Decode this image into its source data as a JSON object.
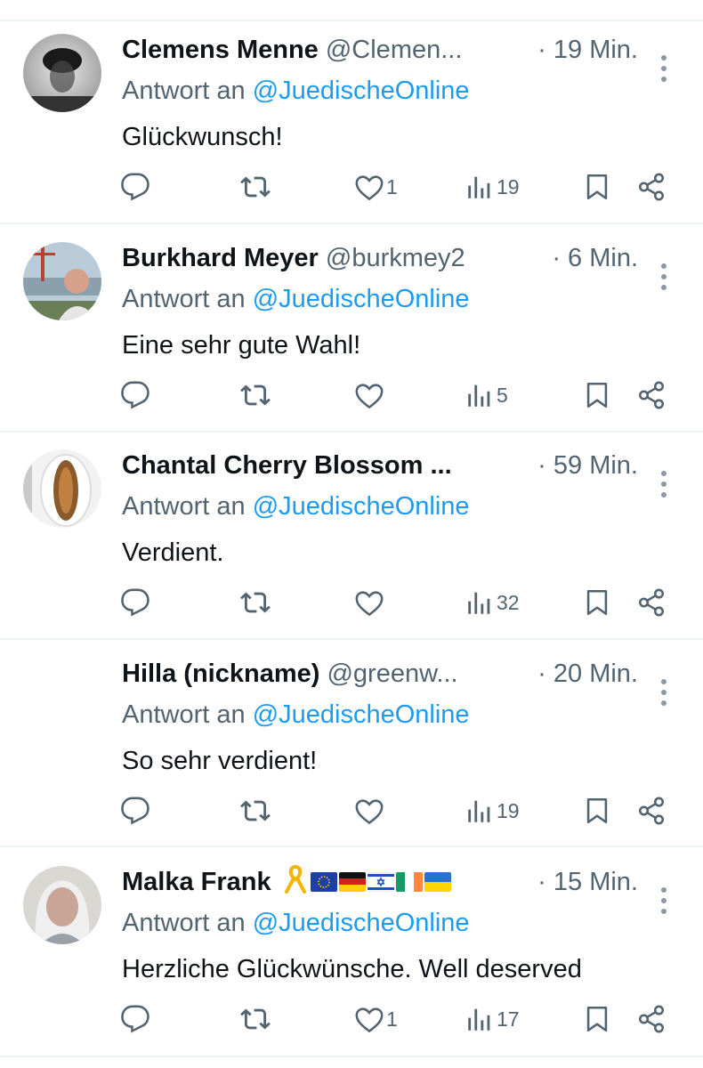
{
  "colors": {
    "link": "#1d9bf0",
    "secondary": "#536471",
    "primary": "#0f1419",
    "divider": "#eff3f4"
  },
  "replies": [
    {
      "name": "Clemens Menne",
      "handle": "@Clemen...",
      "time": "· 19 Min.",
      "reply_prefix": "Antwort an",
      "mention": "@JuedischeOnline",
      "text": "Glückwunsch!",
      "likes": "1",
      "views": "19",
      "avatar": "grayscale-photo-avatar"
    },
    {
      "name": "Burkhard Meyer",
      "handle": "@burkmey2",
      "time": "· 6 Min.",
      "reply_prefix": "Antwort an",
      "mention": "@JuedischeOnline",
      "text": "Eine sehr gute Wahl!",
      "likes": "",
      "views": "5",
      "avatar": "golden-gate-photo-avatar"
    },
    {
      "name": "Chantal Cherry Blossom ...",
      "handle": "",
      "time": "· 59 Min.",
      "reply_prefix": "Antwort an",
      "mention": "@JuedischeOnline",
      "text": "Verdient.",
      "likes": "",
      "views": "32",
      "avatar": "fish-plate-avatar"
    },
    {
      "name": "Hilla (nickname)",
      "handle": "@greenw...",
      "time": "· 20 Min.",
      "reply_prefix": "Antwort an",
      "mention": "@JuedischeOnline",
      "text": "So sehr verdient!",
      "likes": "",
      "views": "19",
      "avatar": "no-avatar"
    },
    {
      "name": "Malka Frank",
      "handle": "",
      "name_emojis": [
        "yellow-ribbon-icon",
        "eu-flag-icon",
        "germany-flag-icon",
        "israel-flag-icon",
        "ireland-flag-icon",
        "ukraine-flag-icon"
      ],
      "time": "· 15 Min.",
      "reply_prefix": "Antwort an",
      "mention": "@JuedischeOnline",
      "text": "Herzliche Glückwünsche. Well deserved",
      "likes": "1",
      "views": "17",
      "avatar": "woman-portrait-avatar"
    }
  ]
}
